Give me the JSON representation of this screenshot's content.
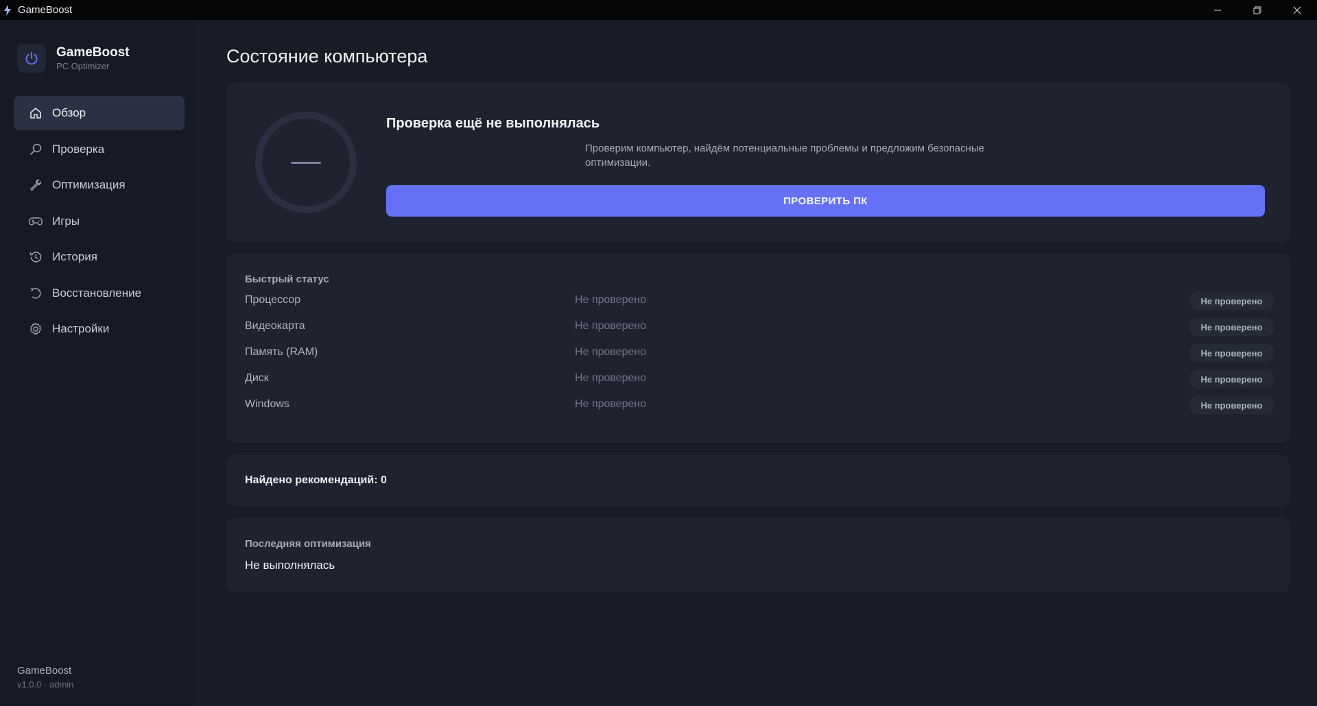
{
  "window": {
    "title": "GameBoost"
  },
  "brand": {
    "name": "GameBoost",
    "subtitle": "PC Optimizer"
  },
  "nav": [
    {
      "label": "Обзор",
      "icon": "home-icon",
      "active": true
    },
    {
      "label": "Проверка",
      "icon": "search-icon",
      "active": false
    },
    {
      "label": "Оптимизация",
      "icon": "wrench-icon",
      "active": false
    },
    {
      "label": "Игры",
      "icon": "gamepad-icon",
      "active": false
    },
    {
      "label": "История",
      "icon": "history-icon",
      "active": false
    },
    {
      "label": "Восстановление",
      "icon": "restore-icon",
      "active": false
    },
    {
      "label": "Настройки",
      "icon": "gear-icon",
      "active": false
    }
  ],
  "footer": {
    "app": "GameBoost",
    "version": "v1.0.0 · admin"
  },
  "page": {
    "title": "Состояние компьютера"
  },
  "hero": {
    "title": "Проверка ещё не выполнялась",
    "description": "Проверим компьютер, найдём потенциальные проблемы и предложим безопасные оптимизации.",
    "button": "ПРОВЕРИТЬ ПК"
  },
  "quick_status": {
    "title": "Быстрый статус",
    "rows": [
      {
        "name": "Процессор",
        "value": "Не проверено",
        "badge": "Не проверено"
      },
      {
        "name": "Видеокарта",
        "value": "Не проверено",
        "badge": "Не проверено"
      },
      {
        "name": "Память (RAM)",
        "value": "Не проверено",
        "badge": "Не проверено"
      },
      {
        "name": "Диск",
        "value": "Не проверено",
        "badge": "Не проверено"
      },
      {
        "name": "Windows",
        "value": "Не проверено",
        "badge": "Не проверено"
      }
    ]
  },
  "recommendations": {
    "text": "Найдено рекомендаций: 0"
  },
  "last_optimization": {
    "title": "Последняя оптимизация",
    "value": "Не выполнялась"
  },
  "colors": {
    "accent": "#6570f4",
    "background": "#181c27",
    "card": "#1f2330"
  }
}
